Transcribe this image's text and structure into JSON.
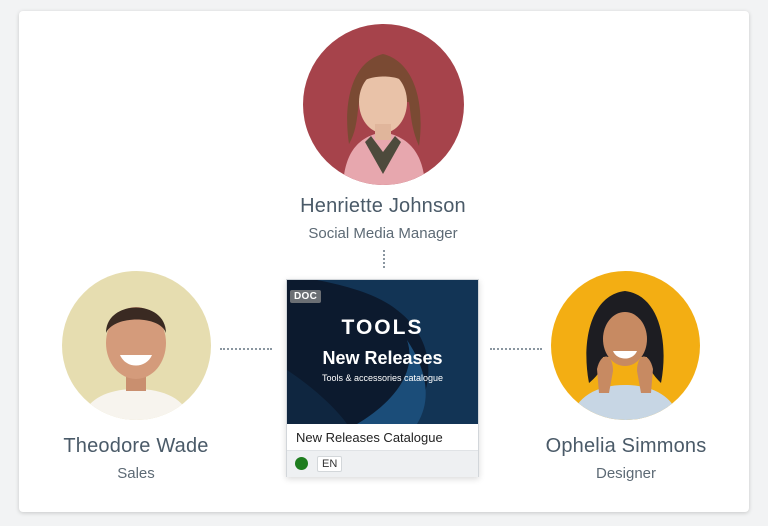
{
  "people": {
    "top": {
      "name": "Henriette Johnson",
      "role": "Social Media Manager",
      "avatar_bg": "#a6434b"
    },
    "left": {
      "name": "Theodore Wade",
      "role": "Sales",
      "avatar_bg": "#e6ddb0"
    },
    "right": {
      "name": "Ophelia Simmons",
      "role": "Designer",
      "avatar_bg": "#f3ae13"
    }
  },
  "document": {
    "badge": "DOC",
    "thumb_brand": "TOOLS",
    "thumb_title": "New Releases",
    "thumb_subtitle": "Tools & accessories catalogue",
    "title": "New Releases Catalogue",
    "language": "EN",
    "status_color": "#1e7d1e"
  }
}
